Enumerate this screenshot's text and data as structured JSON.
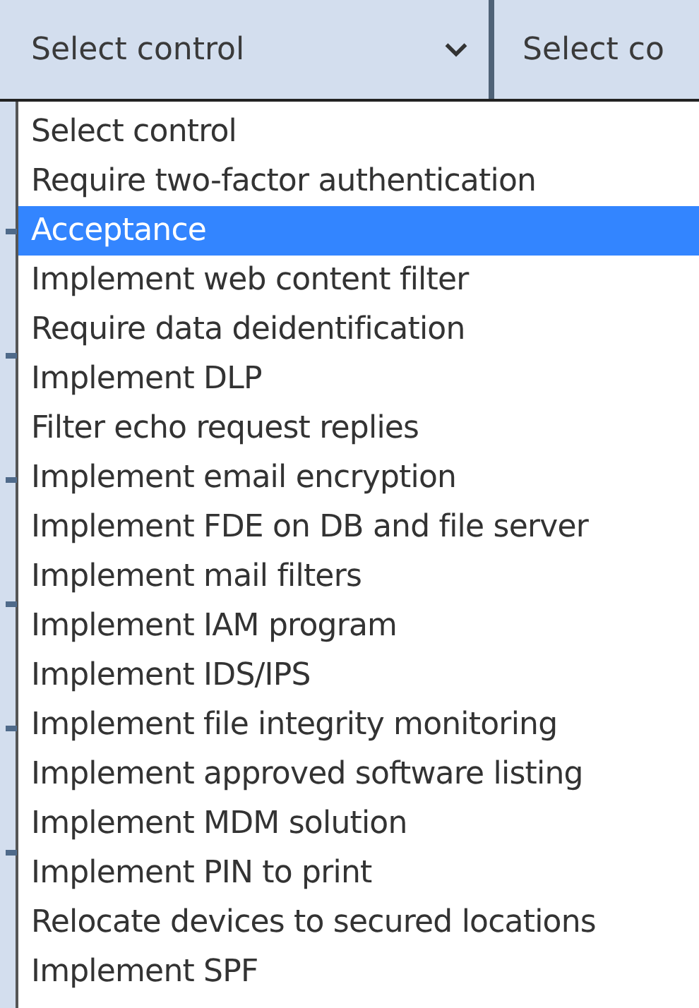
{
  "selects": [
    {
      "value": "Select control",
      "expanded": true
    },
    {
      "value": "Select co"
    }
  ],
  "dropdown": {
    "options": [
      {
        "label": "Select control",
        "selected": false
      },
      {
        "label": "Require two-factor authentication",
        "selected": false
      },
      {
        "label": "Acceptance",
        "selected": true
      },
      {
        "label": "Implement web content filter",
        "selected": false
      },
      {
        "label": "Require data deidentification",
        "selected": false
      },
      {
        "label": "Implement DLP",
        "selected": false
      },
      {
        "label": "Filter echo request replies",
        "selected": false
      },
      {
        "label": "Implement email encryption",
        "selected": false
      },
      {
        "label": "Implement FDE on DB and file server",
        "selected": false
      },
      {
        "label": "Implement mail filters",
        "selected": false
      },
      {
        "label": "Implement IAM program",
        "selected": false
      },
      {
        "label": "Implement IDS/IPS",
        "selected": false
      },
      {
        "label": "Implement file integrity monitoring",
        "selected": false
      },
      {
        "label": "Implement approved software listing",
        "selected": false
      },
      {
        "label": "Implement MDM solution",
        "selected": false
      },
      {
        "label": "Implement PIN to print",
        "selected": false
      },
      {
        "label": "Relocate devices to secured locations",
        "selected": false
      },
      {
        "label": "Implement SPF",
        "selected": false
      }
    ]
  }
}
